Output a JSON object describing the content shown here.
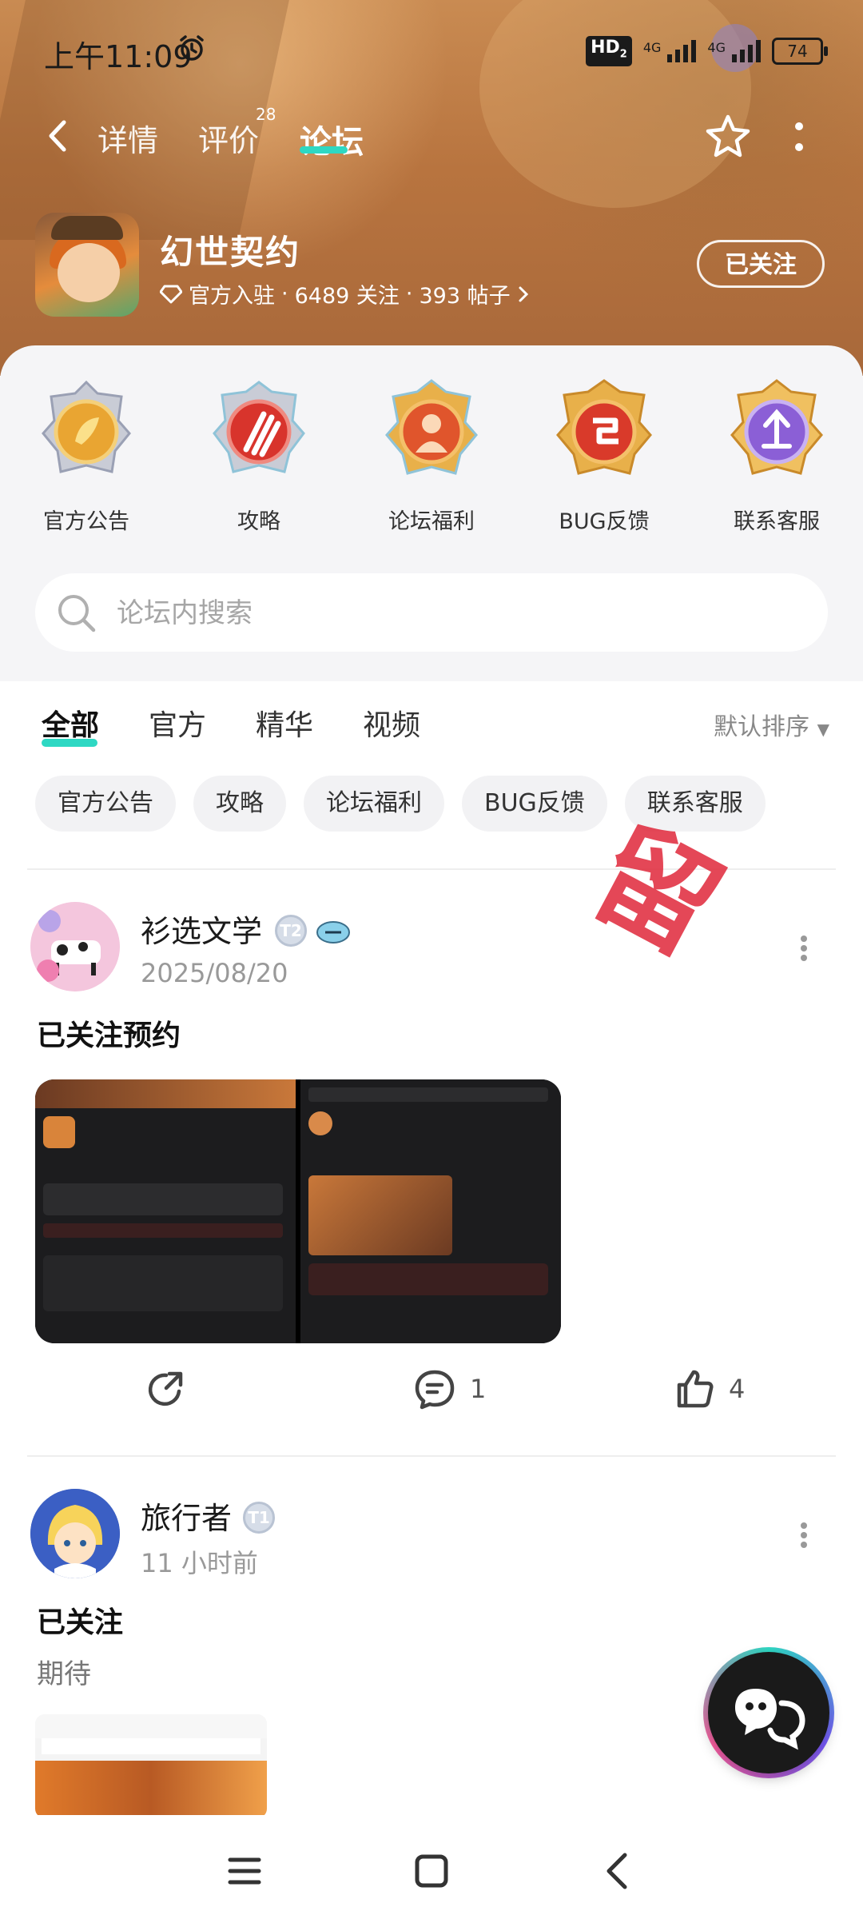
{
  "status_bar": {
    "time": "上午11:09",
    "network_badge": "HD",
    "network_badge_sub": "2",
    "signal1_label": "4G",
    "signal2_label": "4G",
    "battery": "74"
  },
  "nav": {
    "tabs": [
      {
        "label": "详情"
      },
      {
        "label": "评价",
        "badge": "28"
      },
      {
        "label": "论坛"
      }
    ],
    "active_tab": "论坛"
  },
  "game": {
    "title": "幻世契约",
    "official": "官方入驻",
    "followers": "6489 关注",
    "posts": "393 帖子",
    "follow_button": "已关注"
  },
  "categories": [
    {
      "label": "官方公告",
      "icon": "announcement-badge-icon",
      "color": "#e9a532"
    },
    {
      "label": "攻略",
      "icon": "claw-strategy-badge-icon",
      "color": "#d8342c"
    },
    {
      "label": "论坛福利",
      "icon": "gift-welfare-badge-icon",
      "color": "#e0552c"
    },
    {
      "label": "BUG反馈",
      "icon": "bug-feedback-badge-icon",
      "color": "#d93a2a"
    },
    {
      "label": "联系客服",
      "icon": "support-badge-icon",
      "color": "#8b5fd6"
    }
  ],
  "search": {
    "placeholder": "论坛内搜索"
  },
  "filter_tabs": [
    "全部",
    "官方",
    "精华",
    "视频"
  ],
  "sort_label": "默认排序",
  "chips": [
    "官方公告",
    "攻略",
    "论坛福利",
    "BUG反馈",
    "联系客服"
  ],
  "watermark": "留",
  "posts": [
    {
      "author": "衫选文学",
      "level": "T2",
      "date": "2025/08/20",
      "title": "已关注预约",
      "body": "",
      "comments": "1",
      "likes": "4"
    },
    {
      "author": "旅行者",
      "level": "T1",
      "date": "11 小时前",
      "title": "已关注",
      "body": "期待"
    }
  ],
  "colors": {
    "accent": "#2ed8c3",
    "banner": "#b8743f"
  }
}
